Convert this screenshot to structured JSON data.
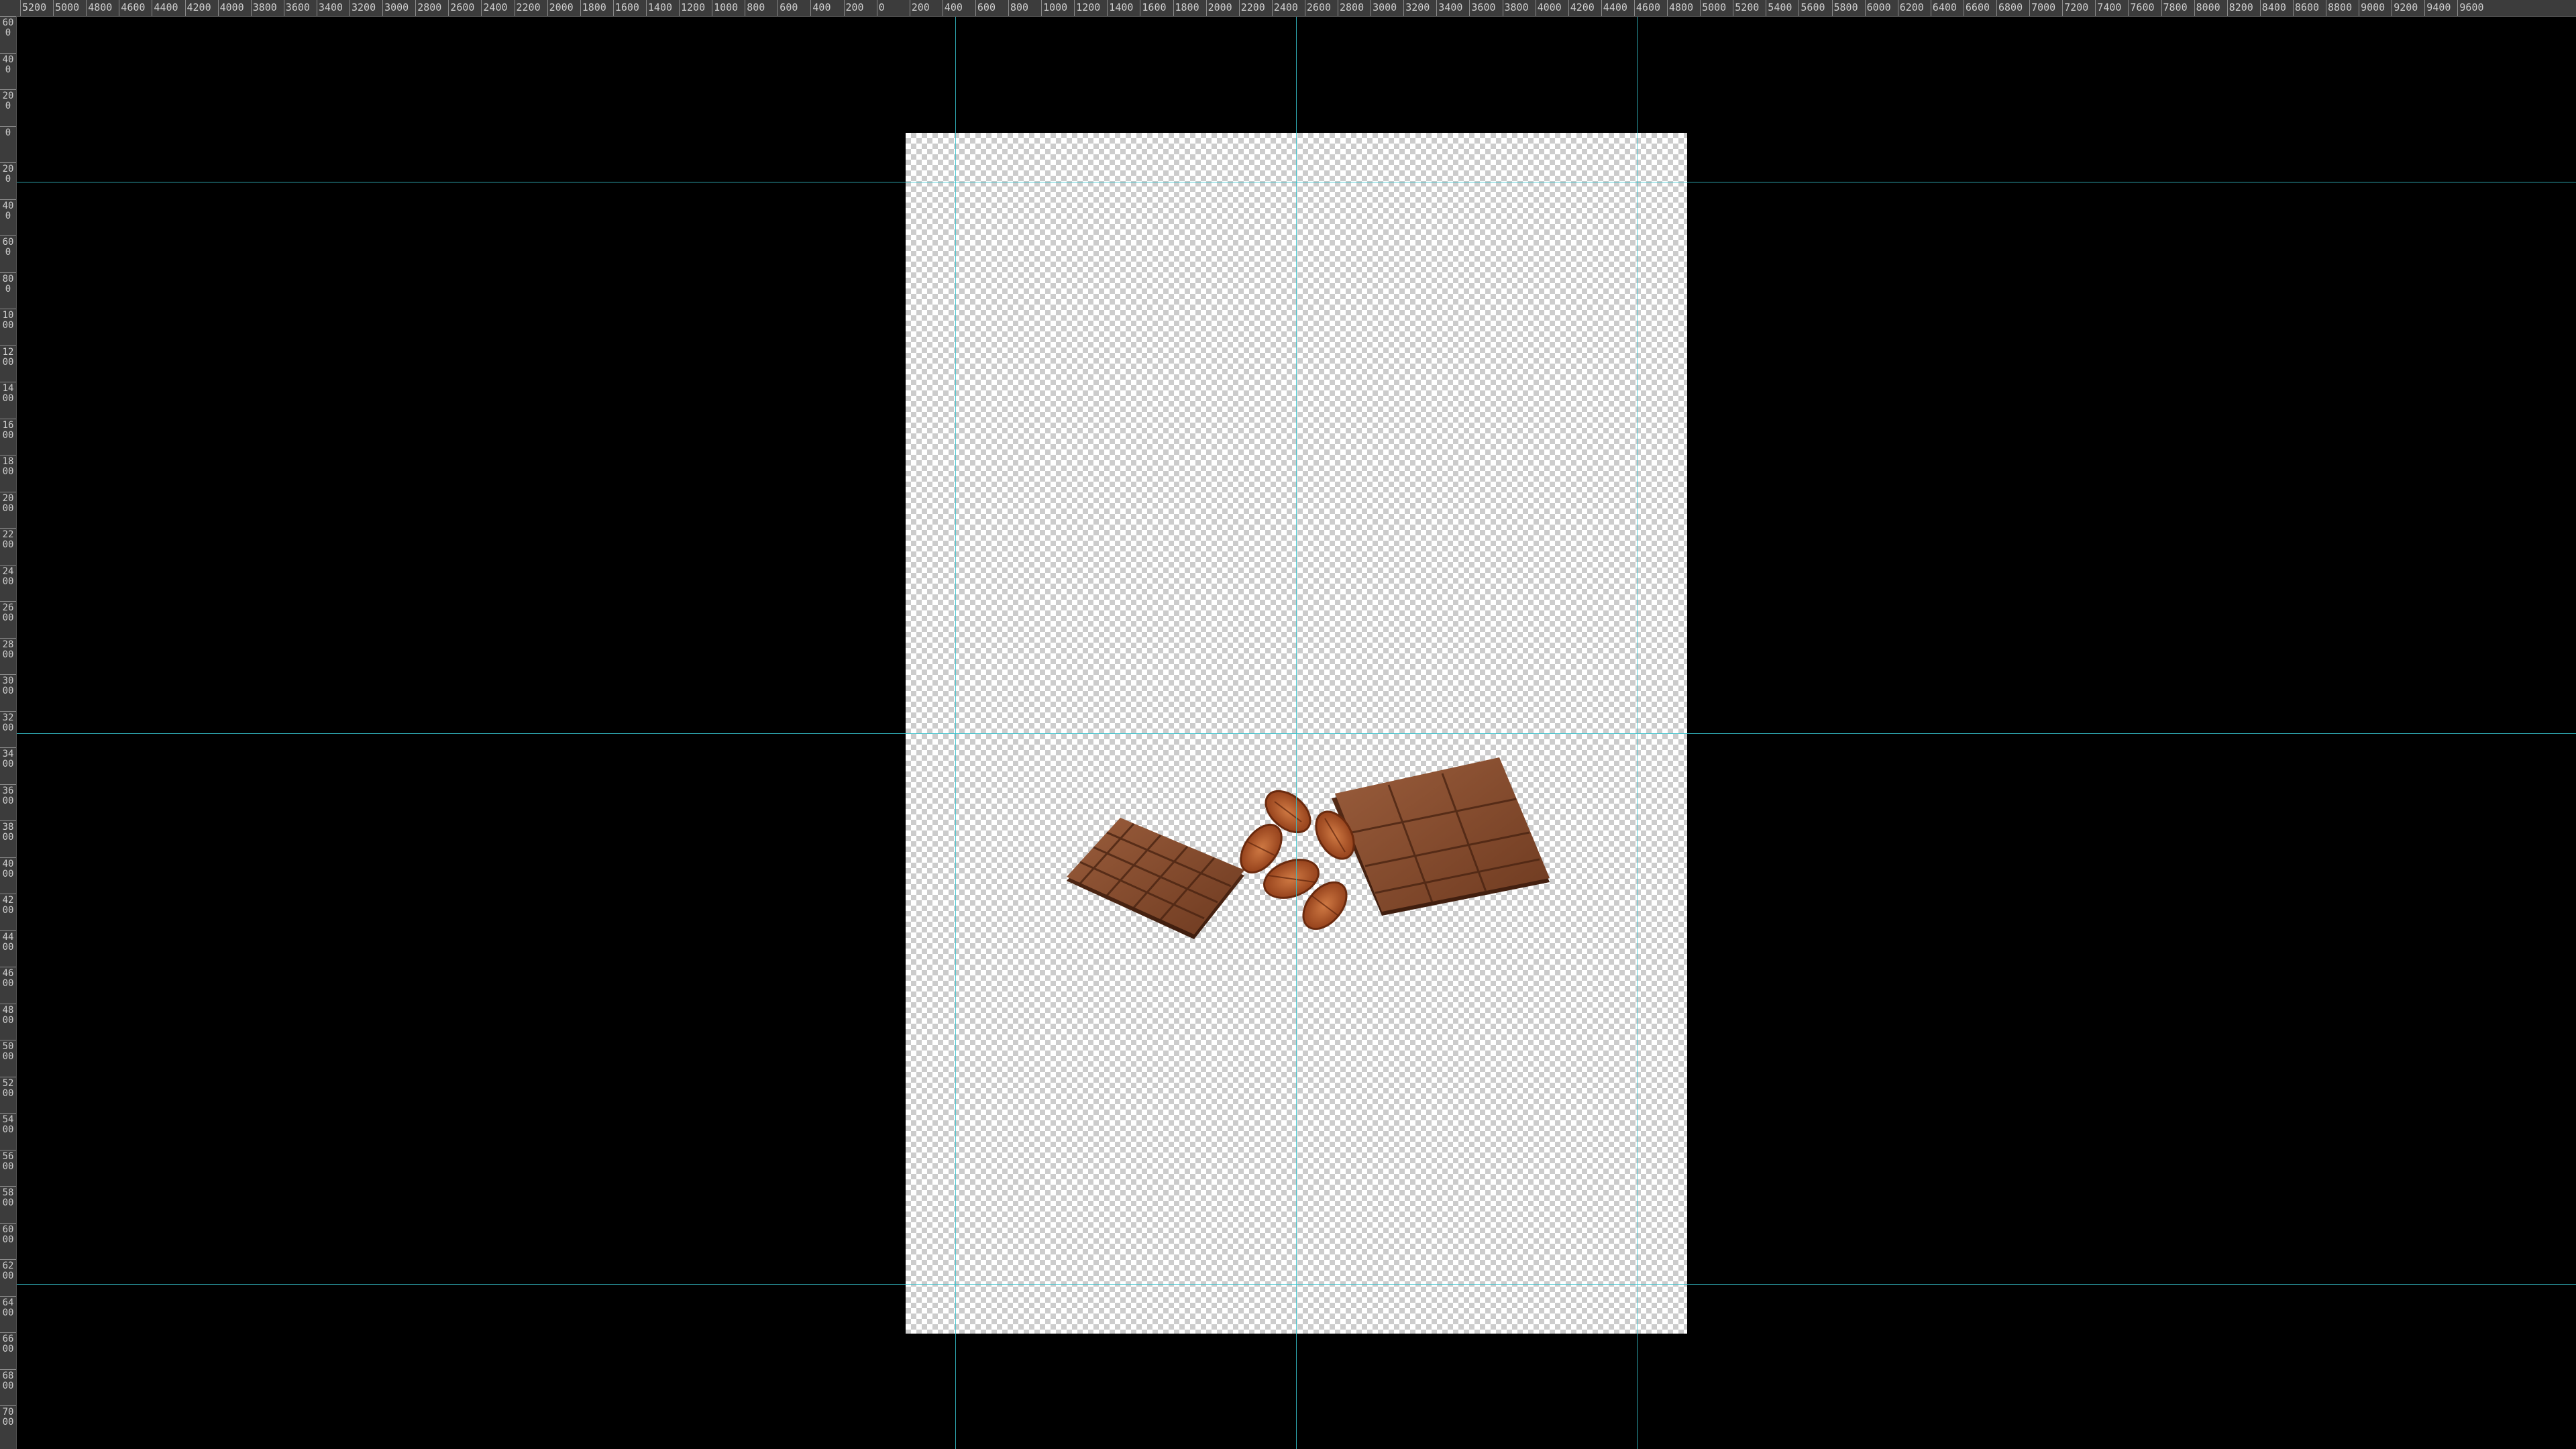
{
  "app": {
    "view": "canvas-workspace"
  },
  "ruler": {
    "horizontal_labels": [
      "5200",
      "5000",
      "4800",
      "4600",
      "4400",
      "4200",
      "4000",
      "3800",
      "3600",
      "3400",
      "3200",
      "3000",
      "2800",
      "2600",
      "2400",
      "2200",
      "2000",
      "1800",
      "1600",
      "1400",
      "1200",
      "1000",
      "800",
      "600",
      "400",
      "200",
      "0",
      "200",
      "400",
      "600",
      "800",
      "1000",
      "1200",
      "1400",
      "1600",
      "1800",
      "2000",
      "2200",
      "2400",
      "2600",
      "2800",
      "3000",
      "3200",
      "3400",
      "3600",
      "3800",
      "4000",
      "4200",
      "4400",
      "4600",
      "4800",
      "5000",
      "5200",
      "5400",
      "5600",
      "5800",
      "6000",
      "6200",
      "6400",
      "6600",
      "6800",
      "7000",
      "7200",
      "7400",
      "7600",
      "7800",
      "8000",
      "8200",
      "8400",
      "8600",
      "8800",
      "9000",
      "9200",
      "9400",
      "9600"
    ],
    "vertical_labels": [
      "600",
      "400",
      "200",
      "0",
      "200",
      "400",
      "600",
      "800",
      "1000",
      "1200",
      "1400",
      "1600",
      "1800",
      "2000",
      "2200",
      "2400",
      "2600",
      "2800",
      "3000",
      "3200",
      "3400",
      "3600",
      "3800",
      "4000",
      "4200",
      "4400",
      "4600",
      "4800",
      "5000",
      "5200",
      "5400",
      "5600",
      "5800",
      "6000",
      "6200",
      "6400",
      "6600",
      "6800",
      "7000"
    ]
  },
  "canvas": {
    "background_color": "#000000",
    "guide_color": "#35c2cc",
    "transparency_grid": [
      "#ffffff",
      "#cccccc"
    ]
  },
  "artwork": {
    "subject_icon": "chocolate-bars-with-pecans-icon",
    "colors": {
      "chocolate": "#6b3a22",
      "chocolate_light": "#8c5234",
      "pecan": "#b5562a"
    }
  }
}
